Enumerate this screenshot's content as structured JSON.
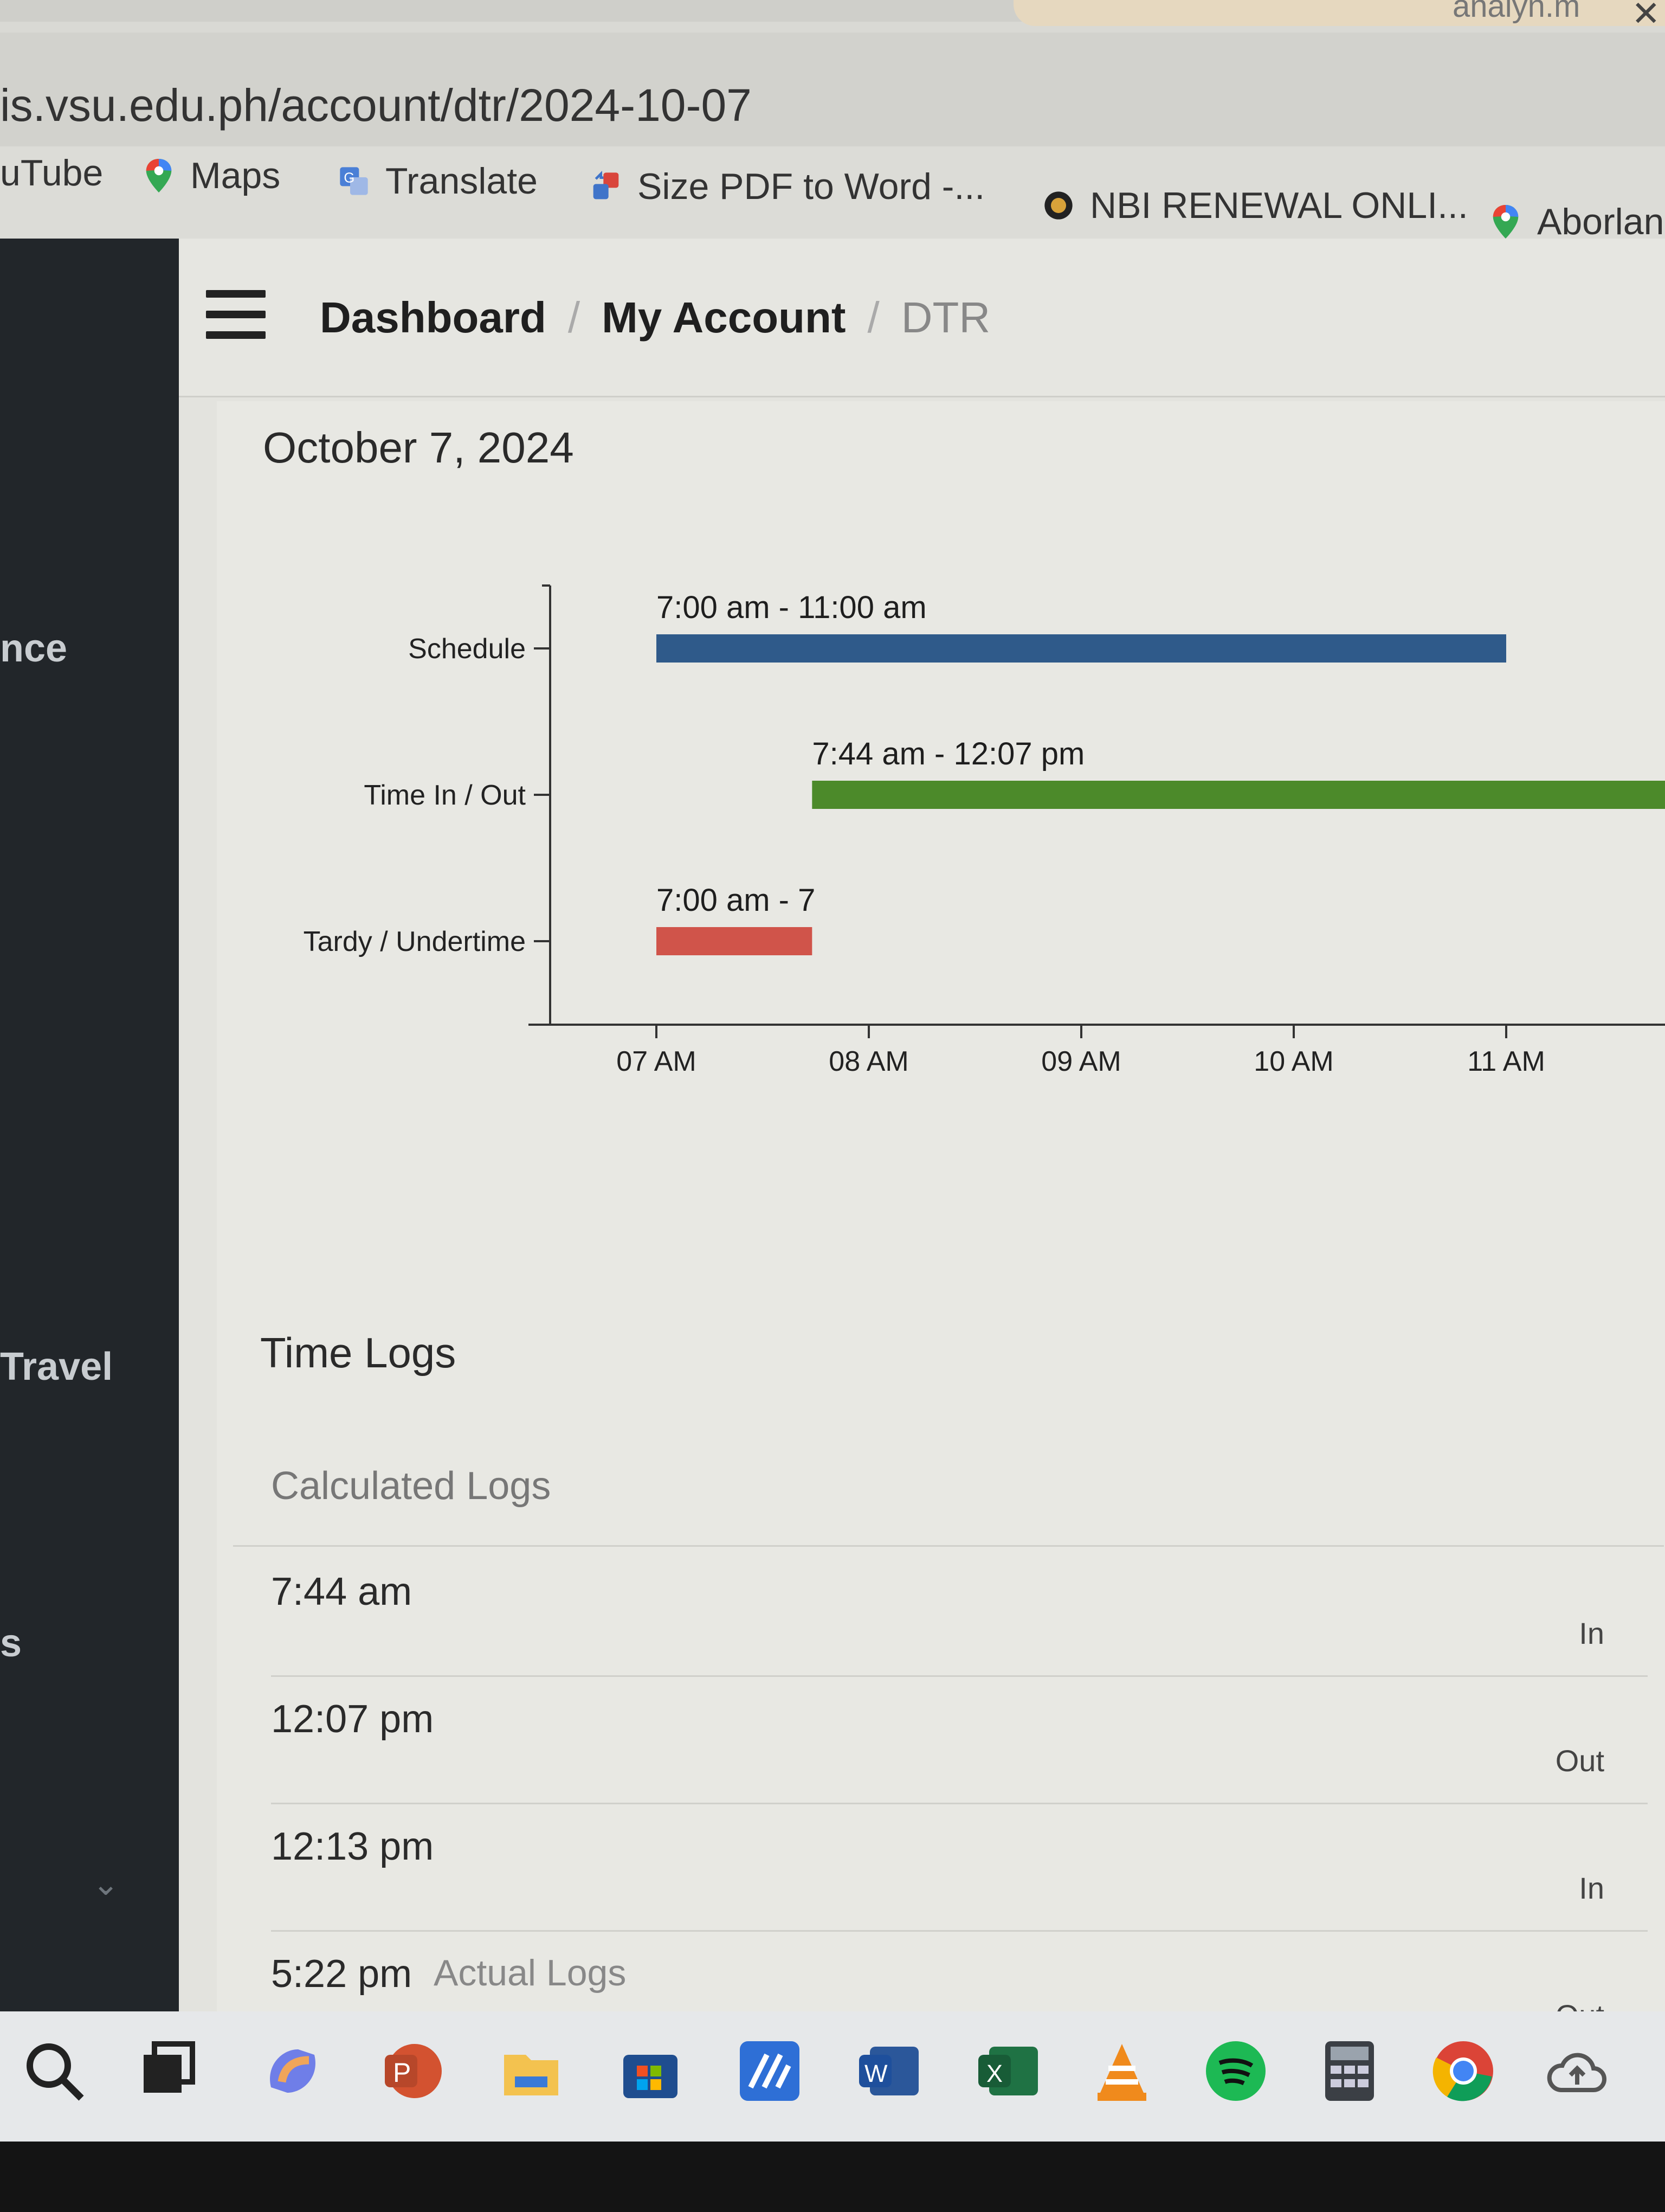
{
  "browser": {
    "profile_name": "analyn.m",
    "close_glyph": "✕",
    "url": "is.vsu.edu.ph/account/dtr/2024-10-07",
    "bookmarks": [
      {
        "label": "uTube",
        "icon": "youtube-icon"
      },
      {
        "label": "Maps",
        "icon": "maps-pin-icon"
      },
      {
        "label": "Translate",
        "icon": "translate-icon"
      },
      {
        "label": "Size PDF to Word -...",
        "icon": "pdf-convert-icon"
      },
      {
        "label": "NBI RENEWAL ONLI...",
        "icon": "nbi-icon"
      },
      {
        "label": "Aborlan",
        "icon": "maps-pin-icon"
      }
    ]
  },
  "sidebar": {
    "items": [
      {
        "label": "nce"
      },
      {
        "label": "Travel"
      },
      {
        "label": "s"
      }
    ],
    "chevron": "⌄"
  },
  "header": {
    "breadcrumb": {
      "dashboard": "Dashboard",
      "account": "My Account",
      "current": "DTR",
      "separator": "/"
    }
  },
  "page": {
    "date": "October 7, 2024"
  },
  "chart_data": {
    "type": "bar",
    "orientation": "horizontal-timeline",
    "categories": [
      "Schedule",
      "Time In / Out",
      "Tardy / Undertime"
    ],
    "x_ticks": [
      "07 AM",
      "08 AM",
      "09 AM",
      "10 AM",
      "11 AM"
    ],
    "x_range_hours": [
      6.5,
      11.75
    ],
    "grid": false,
    "series": [
      {
        "category": "Schedule",
        "start": 7.0,
        "end": 11.0,
        "label": "7:00 am - 11:00 am",
        "color": "#2f5a8a"
      },
      {
        "category": "Time In / Out",
        "start": 7.733,
        "end": 12.117,
        "label": "7:44 am - 12:07 pm",
        "color": "#4c8a2a"
      },
      {
        "category": "Tardy / Undertime",
        "start": 7.0,
        "end": 7.733,
        "label": "7:00 am - 7",
        "color": "#d0544a"
      }
    ]
  },
  "time_logs": {
    "title": "Time Logs",
    "calculated_title": "Calculated Logs",
    "calculated": [
      {
        "time": "7:44 am",
        "type": "In"
      },
      {
        "time": "12:07 pm",
        "type": "Out"
      },
      {
        "time": "12:13 pm",
        "type": "In"
      },
      {
        "time": "5:22 pm",
        "type": "Out"
      }
    ],
    "actual_title": "Actual Logs"
  },
  "taskbar": {
    "icons": [
      "search-icon",
      "task-view-icon",
      "copilot-icon",
      "powerpoint-icon",
      "file-explorer-icon",
      "microsoft-store-icon",
      "app-icon",
      "word-icon",
      "excel-icon",
      "vlc-icon",
      "spotify-icon",
      "calculator-icon",
      "chrome-icon",
      "cloud-icon"
    ]
  }
}
